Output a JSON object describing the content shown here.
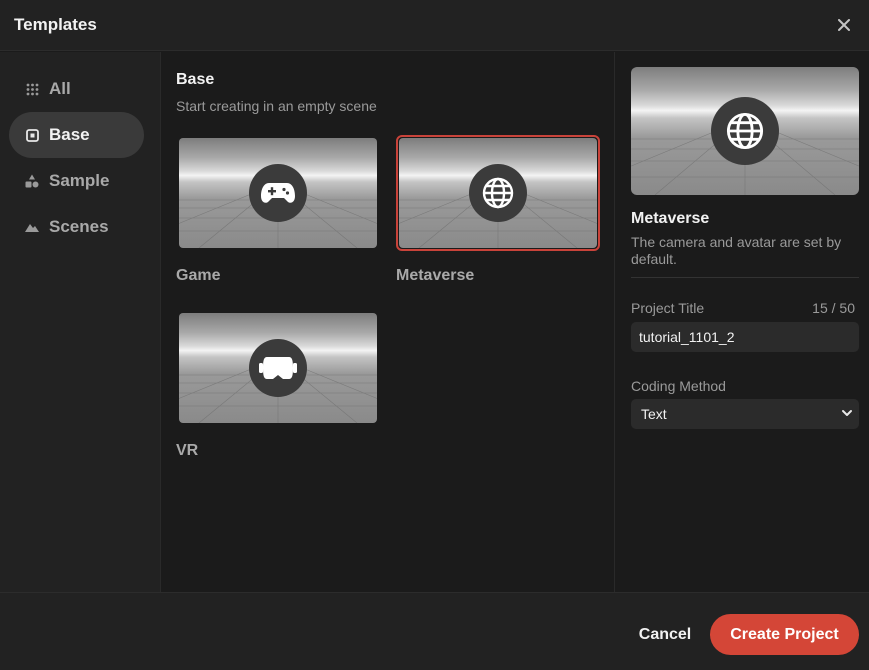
{
  "dialog": {
    "title": "Templates",
    "close_icon": "close-icon"
  },
  "sidebar": {
    "items": [
      {
        "label": "All",
        "icon": "grid-icon",
        "active": false
      },
      {
        "label": "Base",
        "icon": "square-dot-icon",
        "active": true
      },
      {
        "label": "Sample",
        "icon": "shapes-icon",
        "active": false
      },
      {
        "label": "Scenes",
        "icon": "mountain-icon",
        "active": false
      }
    ]
  },
  "main": {
    "title": "Base",
    "subtitle": "Start creating in an empty scene",
    "templates": [
      {
        "label": "Game",
        "icon": "gamepad-icon",
        "selected": false
      },
      {
        "label": "Metaverse",
        "icon": "globe-icon",
        "selected": true
      },
      {
        "label": "VR",
        "icon": "vr-headset-icon",
        "selected": false
      }
    ]
  },
  "details": {
    "title": "Metaverse",
    "description": "The camera and avatar are set by default.",
    "project_title_label": "Project Title",
    "project_title_value": "tutorial_1101_2",
    "counter": "15 / 50",
    "coding_method_label": "Coding Method",
    "coding_method_value": "Text"
  },
  "footer": {
    "cancel_label": "Cancel",
    "create_label": "Create Project"
  },
  "colors": {
    "accent": "#d44637",
    "selected_border": "#c9433a",
    "background": "#1b1b1b"
  }
}
